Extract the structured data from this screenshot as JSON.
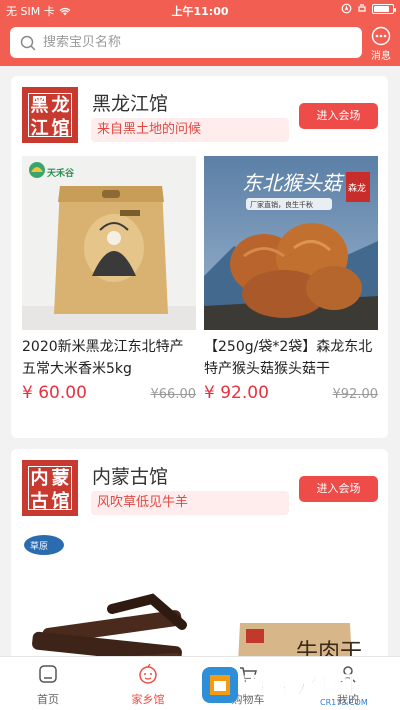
{
  "status_bar": {
    "carrier": "无 SIM 卡",
    "time": "上午11:00",
    "battery_level": 0.85
  },
  "search": {
    "placeholder": "搜索宝贝名称"
  },
  "message": {
    "label": "消息"
  },
  "halls": [
    {
      "seal_chars": [
        "黑",
        "龙",
        "江",
        "馆"
      ],
      "name": "黑龙江馆",
      "slogan": "来自黑土地的问候",
      "button": "进入会场",
      "products": [
        {
          "name": "2020新米黑龙江东北特产五常大米香米5kg",
          "price": "¥ 60.00",
          "old_price": "¥66.00",
          "brand": "天禾谷"
        },
        {
          "name": "【250g/袋*2袋】森龙东北特产猴头菇猴头菇干",
          "price": "¥ 92.00",
          "old_price": "¥92.00",
          "banner": "东北猴头菇",
          "banner_sub": "厂家直销，良生千秋",
          "seal": "森龙"
        }
      ]
    },
    {
      "seal_chars": [
        "内",
        "蒙",
        "古",
        "馆"
      ],
      "name": "内蒙古馆",
      "slogan": "风吹草低见牛羊",
      "button": "进入会场",
      "products": [
        {
          "name": "",
          "price": "",
          "old_price": "",
          "brand": "草原"
        },
        {
          "name": "",
          "price": "",
          "old_price": "",
          "label": "牛肉干"
        }
      ]
    }
  ],
  "tabs": [
    {
      "label": "首页",
      "icon": "home-icon",
      "active": false
    },
    {
      "label": "家乡馆",
      "icon": "face-icon",
      "active": true
    },
    {
      "label": "购物车",
      "icon": "cart-icon",
      "active": false
    },
    {
      "label": "我的",
      "icon": "user-icon",
      "active": false
    }
  ],
  "watermark": {
    "text": "西西软件园",
    "sub": "CR173.COM"
  },
  "colors": {
    "header": "#f25f52",
    "accent": "#ed4c48",
    "price": "#e7323f",
    "slogan_bg": "#ffecec"
  }
}
